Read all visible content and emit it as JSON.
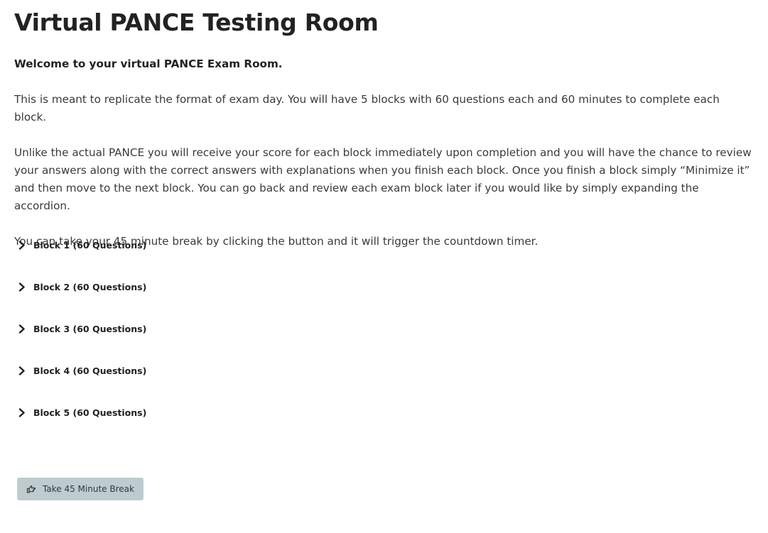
{
  "page": {
    "title": "Virtual PANCE Testing Room"
  },
  "intro": {
    "welcome": "Welcome to your virtual PANCE Exam Room.",
    "paragraph1": "This is meant to replicate the format of exam day. You will have 5 blocks with 60 questions each and 60 minutes to complete each block.",
    "paragraph2": "Unlike the actual PANCE you will receive your score for each block immediately upon completion and you will  have the chance to review your answers along with the correct answers with explanations when you finish each block. Once you finish a block simply “Minimize it” and then move to the next block. You can go back and review each exam block later if you would like by simply expanding the accordion.",
    "paragraph3": "You can take your 45 minute break by clicking the button and it will trigger the countdown timer."
  },
  "accordion": {
    "items": [
      {
        "label": "Block 1 (60 Questions)",
        "icon": "chevron-right-icon"
      },
      {
        "label": "Block 2 (60 Questions)",
        "icon": "chevron-right-icon"
      },
      {
        "label": "Block 3 (60 Questions)",
        "icon": "chevron-right-icon"
      },
      {
        "label": "Block 4 (60 Questions)",
        "icon": "chevron-right-icon"
      },
      {
        "label": "Block 5 (60 Questions)",
        "icon": "chevron-right-icon"
      }
    ]
  },
  "break_button": {
    "label": "Take 45 Minute Break",
    "icon": "hand-pointing-icon",
    "background": "#bfcccf"
  }
}
